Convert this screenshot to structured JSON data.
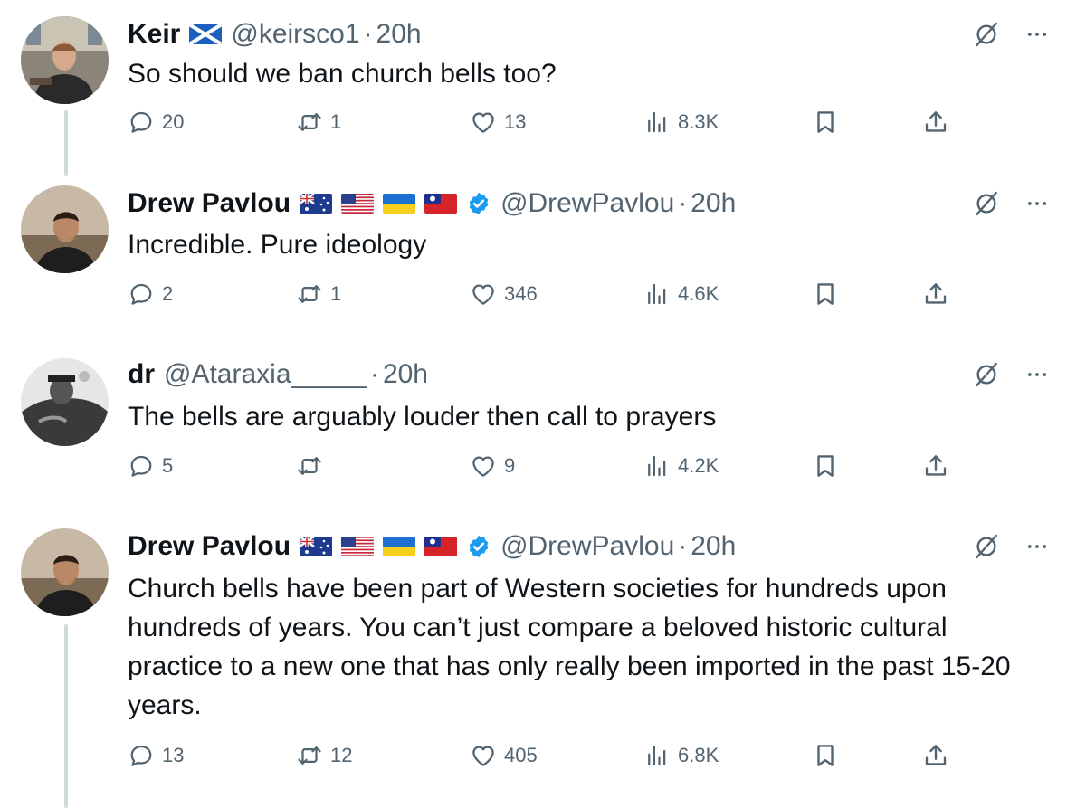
{
  "tweets": [
    {
      "display_name": "Keir",
      "has_flag_scotland": true,
      "verified": false,
      "handle": "@keirsco1",
      "time": "20h",
      "text": "So should we ban church bells too?",
      "replies": "20",
      "retweets": "1",
      "likes": "13",
      "views": "8.3K"
    },
    {
      "display_name": "Drew Pavlou",
      "flags": [
        "flag-australia",
        "flag-usa",
        "flag-ukraine",
        "flag-taiwan"
      ],
      "verified": true,
      "handle": "@DrewPavlou",
      "time": "20h",
      "text": "Incredible. Pure ideology",
      "replies": "2",
      "retweets": "1",
      "likes": "346",
      "views": "4.6K"
    },
    {
      "display_name": "dr",
      "verified": false,
      "handle": "@Ataraxia_____",
      "time": "20h",
      "text": "The bells are arguably louder then call to prayers",
      "replies": "5",
      "retweets": "",
      "likes": "9",
      "views": "4.2K"
    },
    {
      "display_name": "Drew Pavlou",
      "flags": [
        "flag-australia",
        "flag-usa",
        "flag-ukraine",
        "flag-taiwan"
      ],
      "verified": true,
      "handle": "@DrewPavlou",
      "time": "20h",
      "text": "Church bells have been part of Western societies for hundreds upon hundreds of years. You can’t just compare a beloved historic cultural practice to a new one that has only really been imported in the past 15-20 years.",
      "replies": "13",
      "retweets": "12",
      "likes": "405",
      "views": "6.8K"
    }
  ],
  "separator": "·",
  "colors": {
    "text_primary": "#0f1419",
    "text_secondary": "#536471",
    "verified_blue": "#1d9bf0",
    "thread_line": "#cfd9de"
  },
  "icons": [
    "reply-icon",
    "retweet-icon",
    "like-icon",
    "views-icon",
    "bookmark-icon",
    "share-icon",
    "grok-icon",
    "more-icon",
    "verified-badge-icon"
  ]
}
